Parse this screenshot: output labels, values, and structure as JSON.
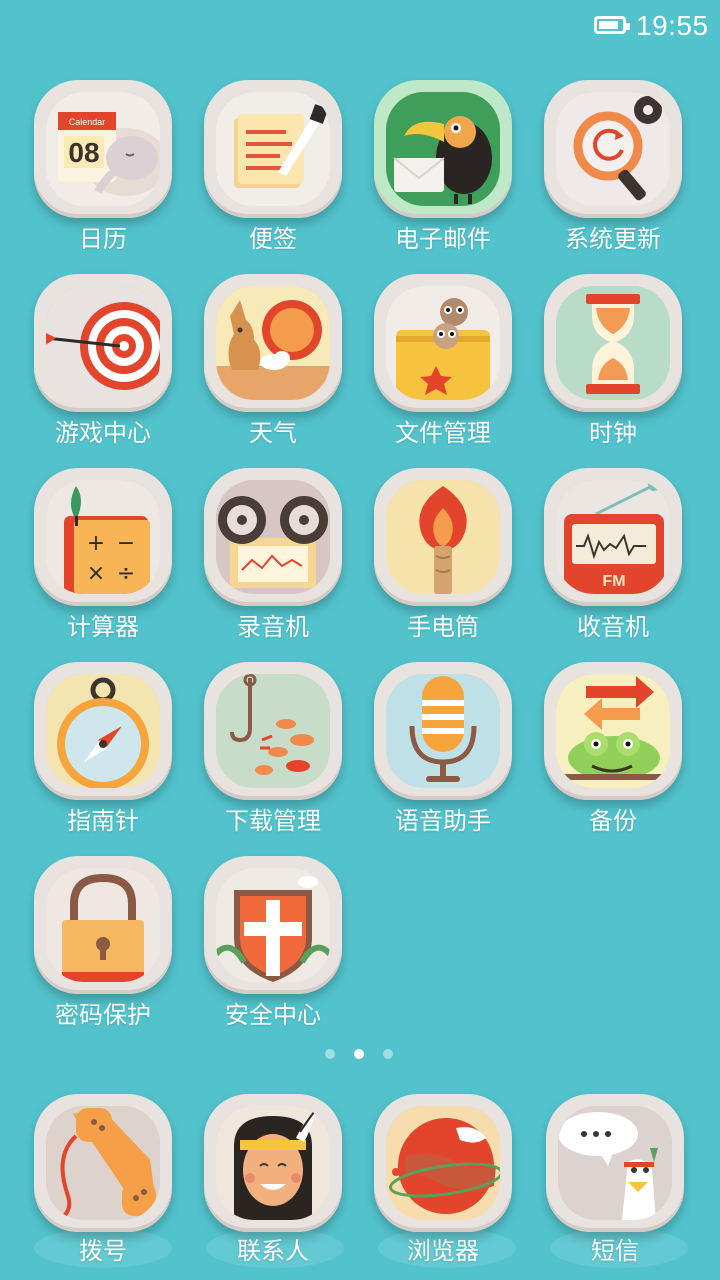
{
  "status_bar": {
    "time": "19:55",
    "battery_level": 0.85
  },
  "apps": [
    {
      "label": "日历",
      "icon": "calendar-icon",
      "calendar_header": "Calendar",
      "calendar_day": "08"
    },
    {
      "label": "便签",
      "icon": "notepad-icon"
    },
    {
      "label": "电子邮件",
      "icon": "toucan-mail-icon"
    },
    {
      "label": "系统更新",
      "icon": "update-magnifier-icon"
    },
    {
      "label": "游戏中心",
      "icon": "target-arrow-icon"
    },
    {
      "label": "天气",
      "icon": "kangaroo-sun-icon"
    },
    {
      "label": "文件管理",
      "icon": "folder-lemurs-icon"
    },
    {
      "label": "时钟",
      "icon": "hourglass-icon"
    },
    {
      "label": "计算器",
      "icon": "calculator-book-icon"
    },
    {
      "label": "录音机",
      "icon": "tape-recorder-icon"
    },
    {
      "label": "手电筒",
      "icon": "torch-flame-icon"
    },
    {
      "label": "收音机",
      "icon": "fm-radio-icon",
      "radio_band": "FM"
    },
    {
      "label": "指南针",
      "icon": "compass-icon"
    },
    {
      "label": "下载管理",
      "icon": "hook-fish-icon"
    },
    {
      "label": "语音助手",
      "icon": "microphone-icon"
    },
    {
      "label": "备份",
      "icon": "chameleon-arrows-icon"
    },
    {
      "label": "密码保护",
      "icon": "padlock-icon"
    },
    {
      "label": "安全中心",
      "icon": "shield-cross-icon"
    }
  ],
  "pager": {
    "count": 3,
    "active": 1
  },
  "dock": [
    {
      "label": "拨号",
      "icon": "phone-handset-icon"
    },
    {
      "label": "联系人",
      "icon": "contact-person-icon"
    },
    {
      "label": "浏览器",
      "icon": "planet-browser-icon"
    },
    {
      "label": "短信",
      "icon": "bird-message-icon"
    }
  ]
}
